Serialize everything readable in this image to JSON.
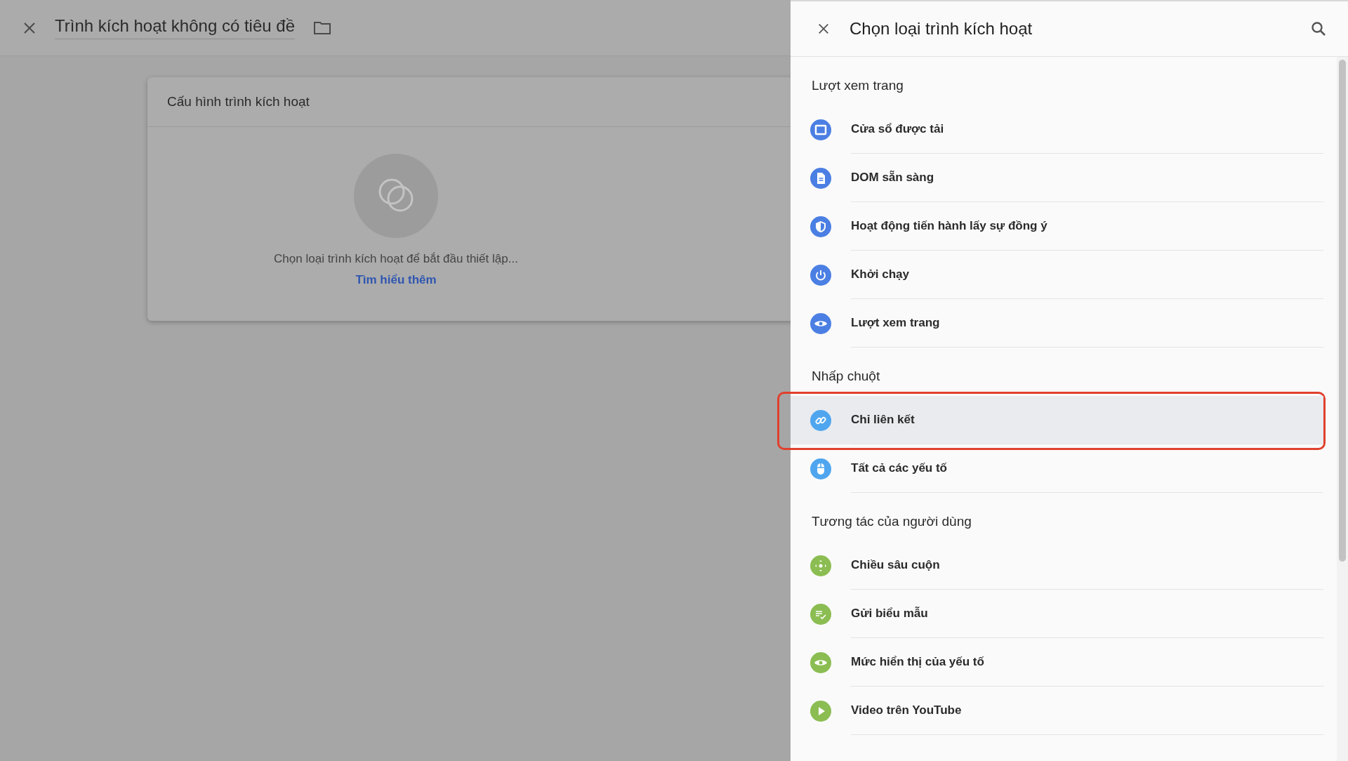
{
  "editor": {
    "title": "Trình kích hoạt không có tiêu đề"
  },
  "card": {
    "title": "Cấu hình trình kích hoạt",
    "message": "Chọn loại trình kích hoạt để bắt đầu thiết lập...",
    "link": "Tìm hiểu thêm"
  },
  "panel": {
    "title": "Chọn loại trình kích hoạt"
  },
  "sections": [
    {
      "title": "Lượt xem trang",
      "color": "#4b7fe3",
      "items": [
        {
          "kind": "window",
          "label": "Cửa sổ được tải",
          "selected": false,
          "highlighted": false
        },
        {
          "kind": "document",
          "label": "DOM sẵn sàng",
          "selected": false,
          "highlighted": false
        },
        {
          "kind": "shield",
          "label": "Hoạt động tiến hành lấy sự đồng ý",
          "selected": false,
          "highlighted": false
        },
        {
          "kind": "power",
          "label": "Khởi chạy",
          "selected": false,
          "highlighted": false
        },
        {
          "kind": "eye",
          "label": "Lượt xem trang",
          "selected": false,
          "highlighted": false
        }
      ]
    },
    {
      "title": "Nhấp chuột",
      "color": "#4fa6ef",
      "items": [
        {
          "kind": "link",
          "label": "Chỉ liên kết",
          "selected": true,
          "highlighted": true
        },
        {
          "kind": "mouse",
          "label": "Tất cả các yếu tố",
          "selected": false,
          "highlighted": false
        }
      ]
    },
    {
      "title": "Tương tác của người dùng",
      "color": "#8bbd52",
      "items": [
        {
          "kind": "move",
          "label": "Chiều sâu cuộn",
          "selected": false,
          "highlighted": false
        },
        {
          "kind": "form",
          "label": "Gửi biểu mẫu",
          "selected": false,
          "highlighted": false
        },
        {
          "kind": "eye",
          "label": "Mức hiển thị của yếu tố",
          "selected": false,
          "highlighted": false
        },
        {
          "kind": "play",
          "label": "Video trên YouTube",
          "selected": false,
          "highlighted": false
        }
      ]
    }
  ]
}
